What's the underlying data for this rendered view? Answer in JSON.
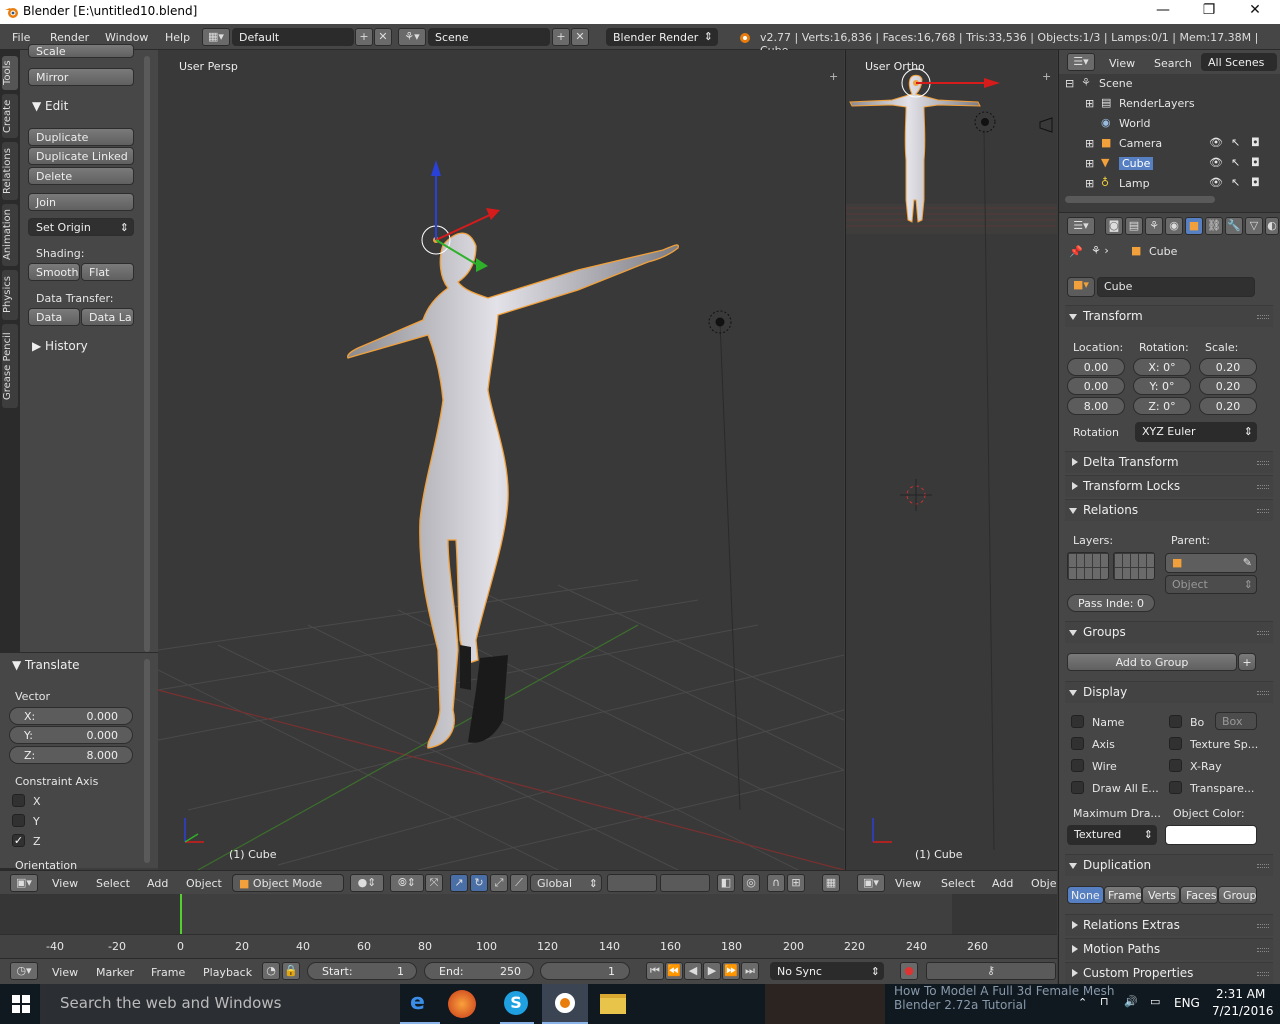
{
  "titlebar": {
    "title": "Blender  [E:\\untitled10.blend]",
    "min": "—",
    "max": "❐",
    "close": "✕"
  },
  "infobar": {
    "menus": [
      "File",
      "Render",
      "Window",
      "Help"
    ],
    "screen": "Default",
    "scene": "Scene",
    "engine": "Blender Render",
    "stats": "v2.77 | Verts:16,836 | Faces:16,768 | Tris:33,536 | Objects:1/3 | Lamps:0/1 | Mem:17.38M | Cube"
  },
  "tabs": [
    "Tools",
    "Create",
    "Relations",
    "Animation",
    "Physics",
    "Grease Pencil"
  ],
  "toolpanel": {
    "scale": "Scale",
    "mirror": "Mirror",
    "edit_header": "Edit",
    "duplicate": "Duplicate",
    "duplicate_linked": "Duplicate Linked",
    "delete": "Delete",
    "join": "Join",
    "set_origin": "Set Origin",
    "shading_label": "Shading:",
    "smooth": "Smooth",
    "flat": "Flat",
    "data_transfer_label": "Data Transfer:",
    "data": "Data",
    "data_layout": "Data La",
    "history": "History"
  },
  "operator": {
    "header": "Translate",
    "vector_label": "Vector",
    "x_label": "X:",
    "x": "0.000",
    "y_label": "Y:",
    "y": "0.000",
    "z_label": "Z:",
    "z": "8.000",
    "constraint_label": "Constraint Axis",
    "cx": "X",
    "cy": "Y",
    "cz": "Z",
    "cz_checked": true,
    "orientation": "Orientation"
  },
  "viewport_main": {
    "label": "User Persp",
    "object": "(1) Cube"
  },
  "viewport_side": {
    "label": "User Ortho",
    "object": "(1) Cube"
  },
  "vp_header": {
    "menus": [
      "View",
      "Select",
      "Add",
      "Object"
    ],
    "mode": "Object Mode",
    "orientation": "Global"
  },
  "vp2_header": {
    "menus": [
      "View",
      "Select",
      "Add",
      "Obje"
    ]
  },
  "timeline": {
    "ruler": [
      "-40",
      "-20",
      "0",
      "20",
      "40",
      "60",
      "80",
      "100",
      "120",
      "140",
      "160",
      "180",
      "200",
      "220",
      "240",
      "260"
    ],
    "menus": [
      "View",
      "Marker",
      "Frame",
      "Playback"
    ],
    "start_label": "Start:",
    "start": "1",
    "end_label": "End:",
    "end": "250",
    "current": "1",
    "sync": "No Sync"
  },
  "outliner": {
    "menus": [
      "View",
      "Search"
    ],
    "filter": "All Scenes",
    "items": [
      "Scene",
      "RenderLayers",
      "World",
      "Camera",
      "Cube",
      "Lamp"
    ]
  },
  "props": {
    "breadcrumb": "Cube",
    "object_name": "Cube",
    "transform": "Transform",
    "location_label": "Location:",
    "rotation_label": "Rotation:",
    "scale_label": "Scale:",
    "loc": [
      "0.00",
      "0.00",
      "8.00"
    ],
    "rot": [
      "X: 0°",
      "Y: 0°",
      "Z: 0°"
    ],
    "scale": [
      "0.20",
      "0.20",
      "0.20"
    ],
    "rotation_mode_label": "Rotation",
    "rotation_mode": "XYZ Euler",
    "delta_transform": "Delta Transform",
    "transform_locks": "Transform Locks",
    "relations": "Relations",
    "layers_label": "Layers:",
    "parent_label": "Parent:",
    "parent_type": "Object",
    "pass_index": "Pass Inde: 0",
    "groups": "Groups",
    "add_to_group": "Add to Group",
    "display": "Display",
    "display_left": [
      "Name",
      "Axis",
      "Wire",
      "Draw All E..."
    ],
    "display_right": [
      "Bo",
      "Texture Sp...",
      "X-Ray",
      "Transpare..."
    ],
    "bounds_type": "Box",
    "max_draw_label": "Maximum Dra...",
    "max_draw": "Textured",
    "color_label": "Object Color:",
    "duplication": "Duplication",
    "dup_options": [
      "None",
      "Frames",
      "Verts",
      "Faces",
      "Group"
    ],
    "relations_extras": "Relations Extras",
    "motion_paths": "Motion Paths",
    "custom_props": "Custom Properties"
  },
  "taskbar": {
    "search": "Search the web and Windows",
    "video_line1": "How To Model A Full 3d Female Mesh",
    "video_line2": "Blender 2.72a Tutorial",
    "lang": "ENG",
    "time": "2:31 AM",
    "date": "7/21/2016"
  },
  "colors": {
    "accent": "#5680c2",
    "selection": "#f1a03b",
    "background": "#393939"
  }
}
